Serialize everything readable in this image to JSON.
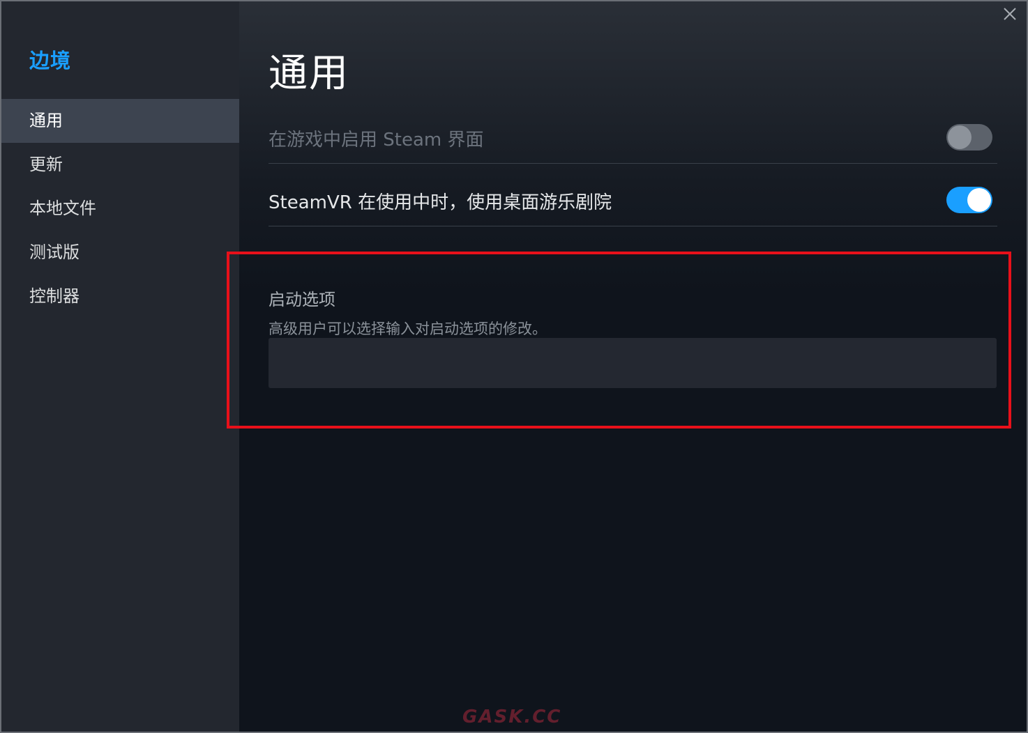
{
  "window": {
    "game_title": "边境",
    "close_icon": "close-icon"
  },
  "sidebar": {
    "items": [
      {
        "label": "通用",
        "active": true
      },
      {
        "label": "更新",
        "active": false
      },
      {
        "label": "本地文件",
        "active": false
      },
      {
        "label": "测试版",
        "active": false
      },
      {
        "label": "控制器",
        "active": false
      }
    ]
  },
  "main": {
    "title": "通用",
    "settings": [
      {
        "label": "在游戏中启用 Steam 界面",
        "enabled": false
      },
      {
        "label": "SteamVR 在使用中时，使用桌面游乐剧院",
        "enabled": true
      }
    ],
    "launch_options": {
      "title": "启动选项",
      "description": "高级用户可以选择输入对启动选项的修改。",
      "value": ""
    }
  },
  "watermark": "GASK.CC",
  "colors": {
    "accent": "#1a9fff",
    "highlight": "#e8101a",
    "sidebar_bg": "#23272f",
    "active_item_bg": "#3d4450"
  }
}
